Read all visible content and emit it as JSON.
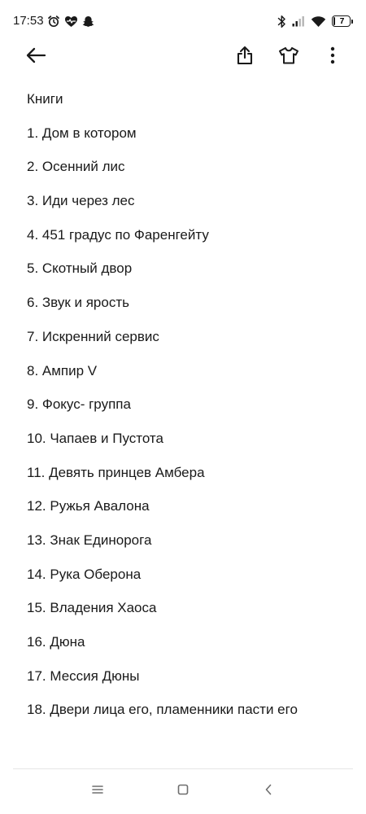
{
  "status_bar": {
    "time": "17:53",
    "battery_level": "7",
    "left_icons": [
      "alarm-icon",
      "heart-pulse-icon",
      "snapchat-ghost-icon"
    ],
    "right_icons": [
      "bluetooth-icon",
      "cellular-signal-icon",
      "wifi-icon",
      "battery-icon"
    ]
  },
  "toolbar": {
    "icons": [
      "back-arrow-icon",
      "share-icon",
      "theme-tshirt-icon",
      "more-vertical-icon"
    ]
  },
  "note": {
    "title": "Книги",
    "items": [
      "1. Дом в котором",
      "2. Осенний лис",
      "3. Иди через лес",
      "4. 451 градус по Фаренгейту",
      "5. Скотный двор",
      "6. Звук и ярость",
      "7. Искренний сервис",
      "8. Ампир V",
      "9. Фокус- группа",
      "10. Чапаев и Пустота",
      "11. Девять принцев Амбера",
      "12. Ружья Авалона",
      "13. Знак Единорога",
      "14. Рука Оберона",
      "15. Владения Хаоса",
      "16. Дюна",
      "17. Мессия Дюны",
      "18. Двери лица его, пламенники пасти его"
    ]
  },
  "navigation": {
    "icons": [
      "menu-icon",
      "home-square-icon",
      "back-chevron-icon"
    ]
  },
  "colors": {
    "background": "#ffffff",
    "text": "#1a1a1a",
    "nav_icons": "#6e6e6e",
    "divider": "#e6e6e6"
  }
}
